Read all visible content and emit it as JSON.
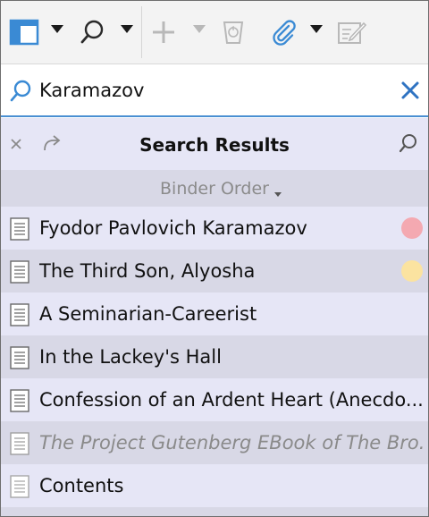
{
  "toolbar": {
    "icons": [
      "layout-icon",
      "search-icon",
      "add-icon",
      "trash-icon",
      "paperclip-icon",
      "edit-icon"
    ],
    "colors": {
      "accent": "#3a8ad4",
      "disabled": "#b8b8b8"
    }
  },
  "search": {
    "query": "Karamazov"
  },
  "results": {
    "title": "Search Results",
    "sort_label": "Binder Order",
    "items": [
      {
        "label": "Fyodor Pavlovich  Karamazov",
        "label_color": "#f4a9b1"
      },
      {
        "label": "The Third Son, Alyosha",
        "label_color": "#fbe3a0"
      },
      {
        "label": "A Seminarian-Careerist"
      },
      {
        "label": "In the Lackey's Hall"
      },
      {
        "label": "Confession of an Ardent Heart (Anecdo..."
      },
      {
        "label": "The Project Gutenberg EBook of The Bro..."
      },
      {
        "label": "Contents"
      }
    ]
  }
}
